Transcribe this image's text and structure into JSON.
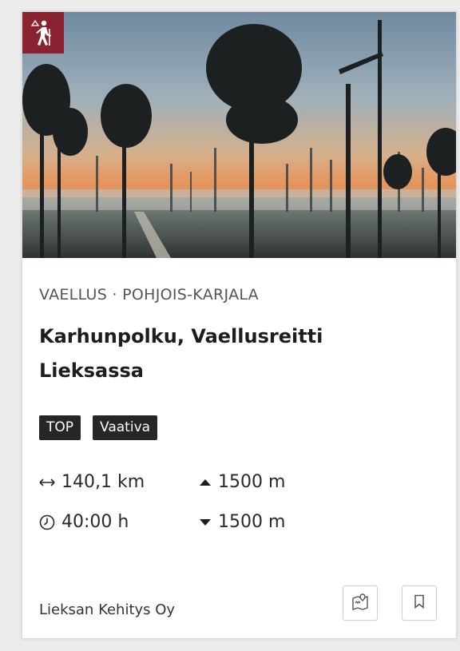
{
  "card": {
    "category": "VAELLUS · POHJOIS-KARJALA",
    "title": "Karhunpolku, Vaellusreitti Lieksassa",
    "tags": [
      "TOP",
      "Vaativa"
    ],
    "stats": {
      "distance": "140,1 km",
      "ascent": "1500 m",
      "duration": "40:00 h",
      "descent": "1500 m"
    },
    "provider": "Lieksan Kehitys Oy",
    "icons": {
      "activity": "hiking-icon",
      "distance": "arrows-horizontal-icon",
      "duration": "clock-icon",
      "ascent": "triangle-up-icon",
      "descent": "triangle-down-icon",
      "map": "map-marker-icon",
      "bookmark": "bookmark-icon"
    },
    "colors": {
      "badge": "#8a2330",
      "tag_background": "#262626",
      "tag_text": "#ffffff"
    }
  }
}
